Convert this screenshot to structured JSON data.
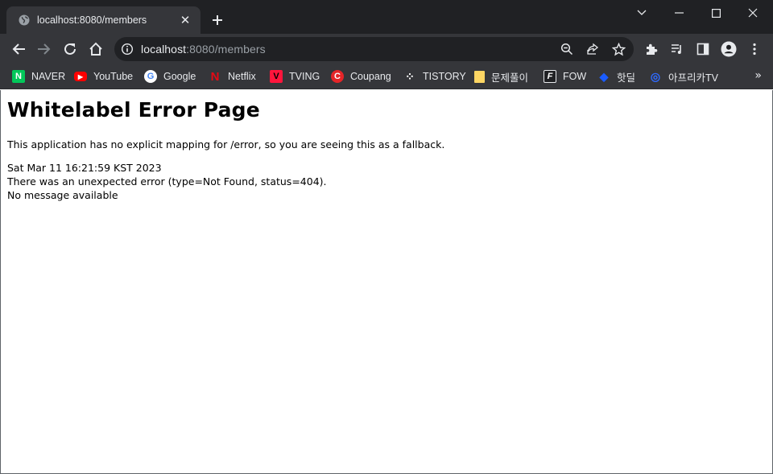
{
  "tab": {
    "title": "localhost:8080/members",
    "close_glyph": "✕",
    "favicon": "globe-icon"
  },
  "new_tab_label": "+",
  "window_controls": [
    "minimize",
    "maximize",
    "close"
  ],
  "omnibox": {
    "host": "localhost",
    "rest": ":8080/members"
  },
  "bookmarks": [
    {
      "label": "NAVER",
      "icon": "naver-icon",
      "color": "#03c75a",
      "glyph": "N"
    },
    {
      "label": "YouTube",
      "icon": "youtube-icon",
      "color": "#ff0000",
      "glyph": "▶"
    },
    {
      "label": "Google",
      "icon": "google-icon",
      "color": "#4285f4",
      "glyph": "G"
    },
    {
      "label": "Netflix",
      "icon": "netflix-icon",
      "color": "#e50914",
      "glyph": "N"
    },
    {
      "label": "TVING",
      "icon": "tving-icon",
      "color": "#ff153c",
      "glyph": "V"
    },
    {
      "label": "Coupang",
      "icon": "coupang-icon",
      "color": "#e52528",
      "glyph": "C"
    },
    {
      "label": "TISTORY",
      "icon": "tistory-icon",
      "color": "#35363a",
      "glyph": "⁘"
    },
    {
      "label": "문제풀이",
      "icon": "folder-icon",
      "color": "#fdd663",
      "glyph": ""
    },
    {
      "label": "FOW",
      "icon": "fow-icon",
      "color": "#202124",
      "glyph": "F"
    },
    {
      "label": "핫딜",
      "icon": "hotdeal-icon",
      "color": "#1a5cff",
      "glyph": "◆"
    },
    {
      "label": "아프리카TV",
      "icon": "afreecatv-icon",
      "color": "#2f6bff",
      "glyph": "◎"
    }
  ],
  "bookmarks_more": "»",
  "page": {
    "title": "Whitelabel Error Page",
    "description": "This application has no explicit mapping for /error, so you are seeing this as a fallback.",
    "timestamp": "Sat Mar 11 16:21:59 KST 2023",
    "error_line": "There was an unexpected error (type=Not Found, status=404).",
    "message_line": "No message available"
  },
  "colors": {
    "frame": "#202124",
    "toolbar": "#35363a",
    "omnibox": "#202124",
    "text_light": "#e8eaed",
    "text_dim": "#9aa0a6"
  }
}
